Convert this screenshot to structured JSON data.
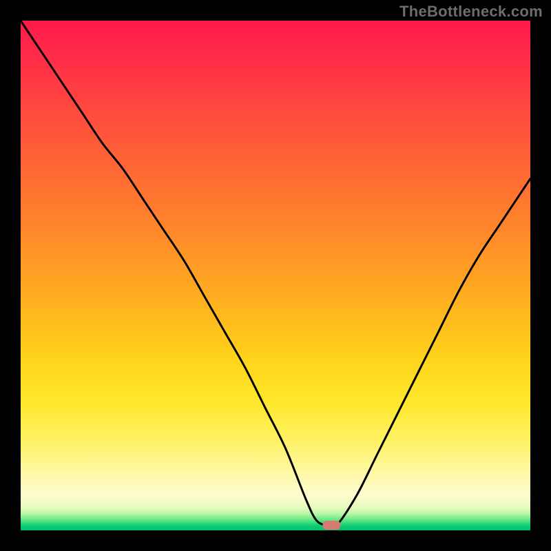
{
  "watermark": "TheBottleneck.com",
  "colors": {
    "frame": "#000000",
    "watermark_text": "#6d6d6d",
    "marker": "#d87a74",
    "curve": "#000000",
    "gradient_stops": [
      "#ff1a4b",
      "#ff2f46",
      "#ff4a3e",
      "#ff6a33",
      "#ff8a2a",
      "#ffb01f",
      "#ffd21a",
      "#ffe82c",
      "#fff26a",
      "#fff8a8",
      "#fdfccf",
      "#e8fbc0",
      "#b7f6a2",
      "#6fe989",
      "#2fd97a",
      "#0acb72",
      "#00c06e"
    ]
  },
  "chart_data": {
    "type": "line",
    "title": "",
    "xlabel": "",
    "ylabel": "",
    "xlim": [
      0,
      100
    ],
    "ylim": [
      0,
      100
    ],
    "series": [
      {
        "name": "bottleneck-curve",
        "x": [
          0,
          4,
          8,
          12,
          16,
          20,
          24,
          28,
          32,
          36,
          40,
          44,
          48,
          52,
          56,
          58,
          60,
          62,
          66,
          70,
          74,
          78,
          82,
          86,
          90,
          94,
          98,
          100
        ],
        "values": [
          100,
          94,
          88,
          82,
          76,
          71,
          65,
          59,
          53,
          46,
          39,
          32,
          24,
          16,
          6,
          2,
          1,
          1,
          7,
          15,
          23,
          31,
          39,
          47,
          54,
          60,
          66,
          69
        ]
      }
    ],
    "minimum": {
      "x": 61,
      "y": 1
    }
  }
}
